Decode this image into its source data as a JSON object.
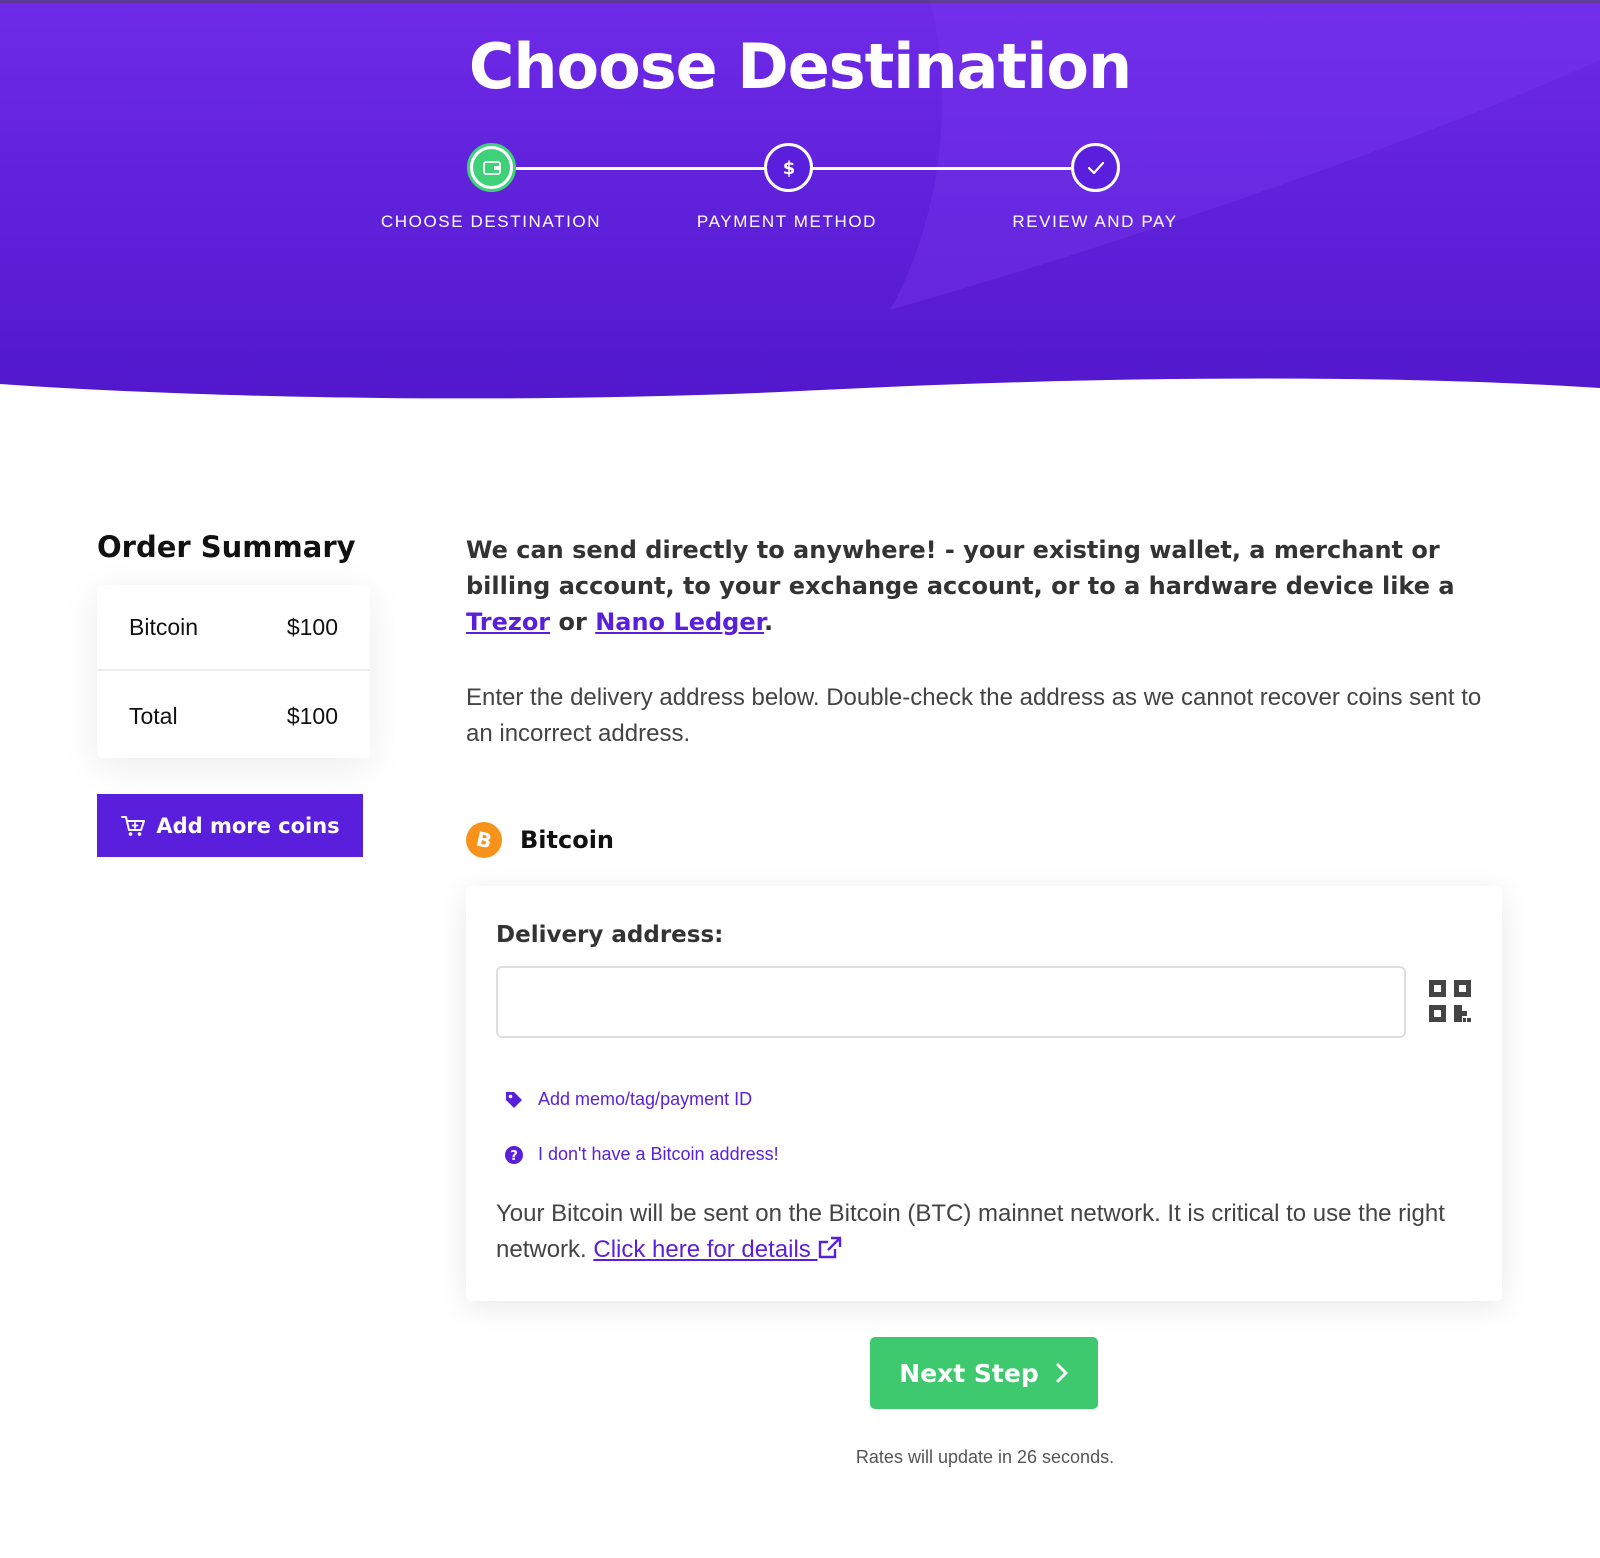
{
  "header": {
    "title": "Choose Destination",
    "steps": [
      {
        "label": "CHOOSE DESTINATION",
        "icon": "wallet-icon",
        "state": "active"
      },
      {
        "label": "PAYMENT METHOD",
        "icon": "dollar-icon",
        "state": "pending"
      },
      {
        "label": "REVIEW AND PAY",
        "icon": "check-icon",
        "state": "pending"
      }
    ]
  },
  "summary": {
    "title": "Order Summary",
    "rows": [
      {
        "label": "Bitcoin",
        "value": "$100"
      },
      {
        "label": "Total",
        "value": "$100"
      }
    ],
    "add_button": "Add more coins"
  },
  "main": {
    "intro_text": "We can send directly to anywhere! - your existing wallet, a merchant or billing account, to your exchange account, or to a hardware device like a ",
    "intro_link_trezor": "Trezor",
    "intro_or": " or ",
    "intro_link_ledger": "Nano Ledger",
    "intro_end": ".",
    "instructions": "Enter the delivery address below. Double-check the address as we cannot recover coins sent to an incorrect address.",
    "coin": {
      "name": "Bitcoin",
      "icon": "bitcoin-icon"
    },
    "address_label": "Delivery address:",
    "address_value": "",
    "memo_link": "Add memo/tag/payment ID",
    "no_address_link": "I don't have a Bitcoin address!",
    "network_note": "Your Bitcoin will be sent on the Bitcoin (BTC) mainnet network. It is critical to use the right network. ",
    "details_link": "Click here for details "
  },
  "footer": {
    "next_button": "Next Step",
    "rates_text": "Rates will update in 26 seconds."
  },
  "colors": {
    "primary": "#5a1fdc",
    "success": "#3fc96e",
    "header_gradient_start": "#6e2ae8",
    "header_gradient_end": "#5218cc"
  }
}
